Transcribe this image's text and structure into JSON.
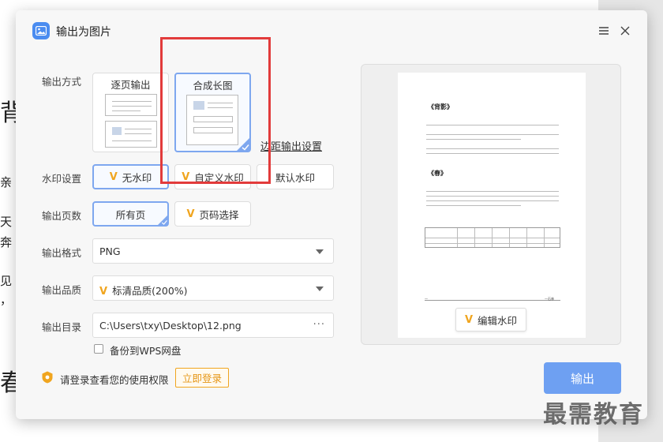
{
  "dialog": {
    "title": "输出为图片"
  },
  "background_fragments": [
    "背",
    "亲",
    "天",
    "奔",
    "见",
    "，",
    "春"
  ],
  "labels": {
    "output_mode": "输出方式",
    "watermark": "水印设置",
    "pages": "输出页数",
    "format": "输出格式",
    "quality": "输出品质",
    "directory": "输出目录"
  },
  "output_mode": {
    "per_page": "逐页输出",
    "long_image": "合成长图",
    "margin_link": "边距输出设置"
  },
  "watermark": {
    "none": "无水印",
    "custom": "自定义水印",
    "default": "默认水印"
  },
  "pages": {
    "all": "所有页",
    "range": "页码选择"
  },
  "format": {
    "value": "PNG"
  },
  "quality": {
    "value": "标清品质(200%)"
  },
  "directory": {
    "value": "C:\\Users\\txy\\Desktop\\12.png",
    "more": "···"
  },
  "backup": {
    "label": "备份到WPS网盘",
    "checked": false
  },
  "login": {
    "text": "请登录查看您的使用权限",
    "button": "立即登录"
  },
  "export_button": "输出",
  "preview": {
    "heading1": "《背影》",
    "heading2": "《春》",
    "edit_watermark": "编辑水印",
    "footer_left": "—",
    "footer_right": "—石林"
  },
  "site_watermark": "最需教育",
  "colors": {
    "accent": "#4a8cf0",
    "selected_border": "#7ea7ef",
    "export_bg": "#6ea0f2",
    "login_orange": "#f0a51f",
    "annotation_red": "#e23b3b"
  }
}
